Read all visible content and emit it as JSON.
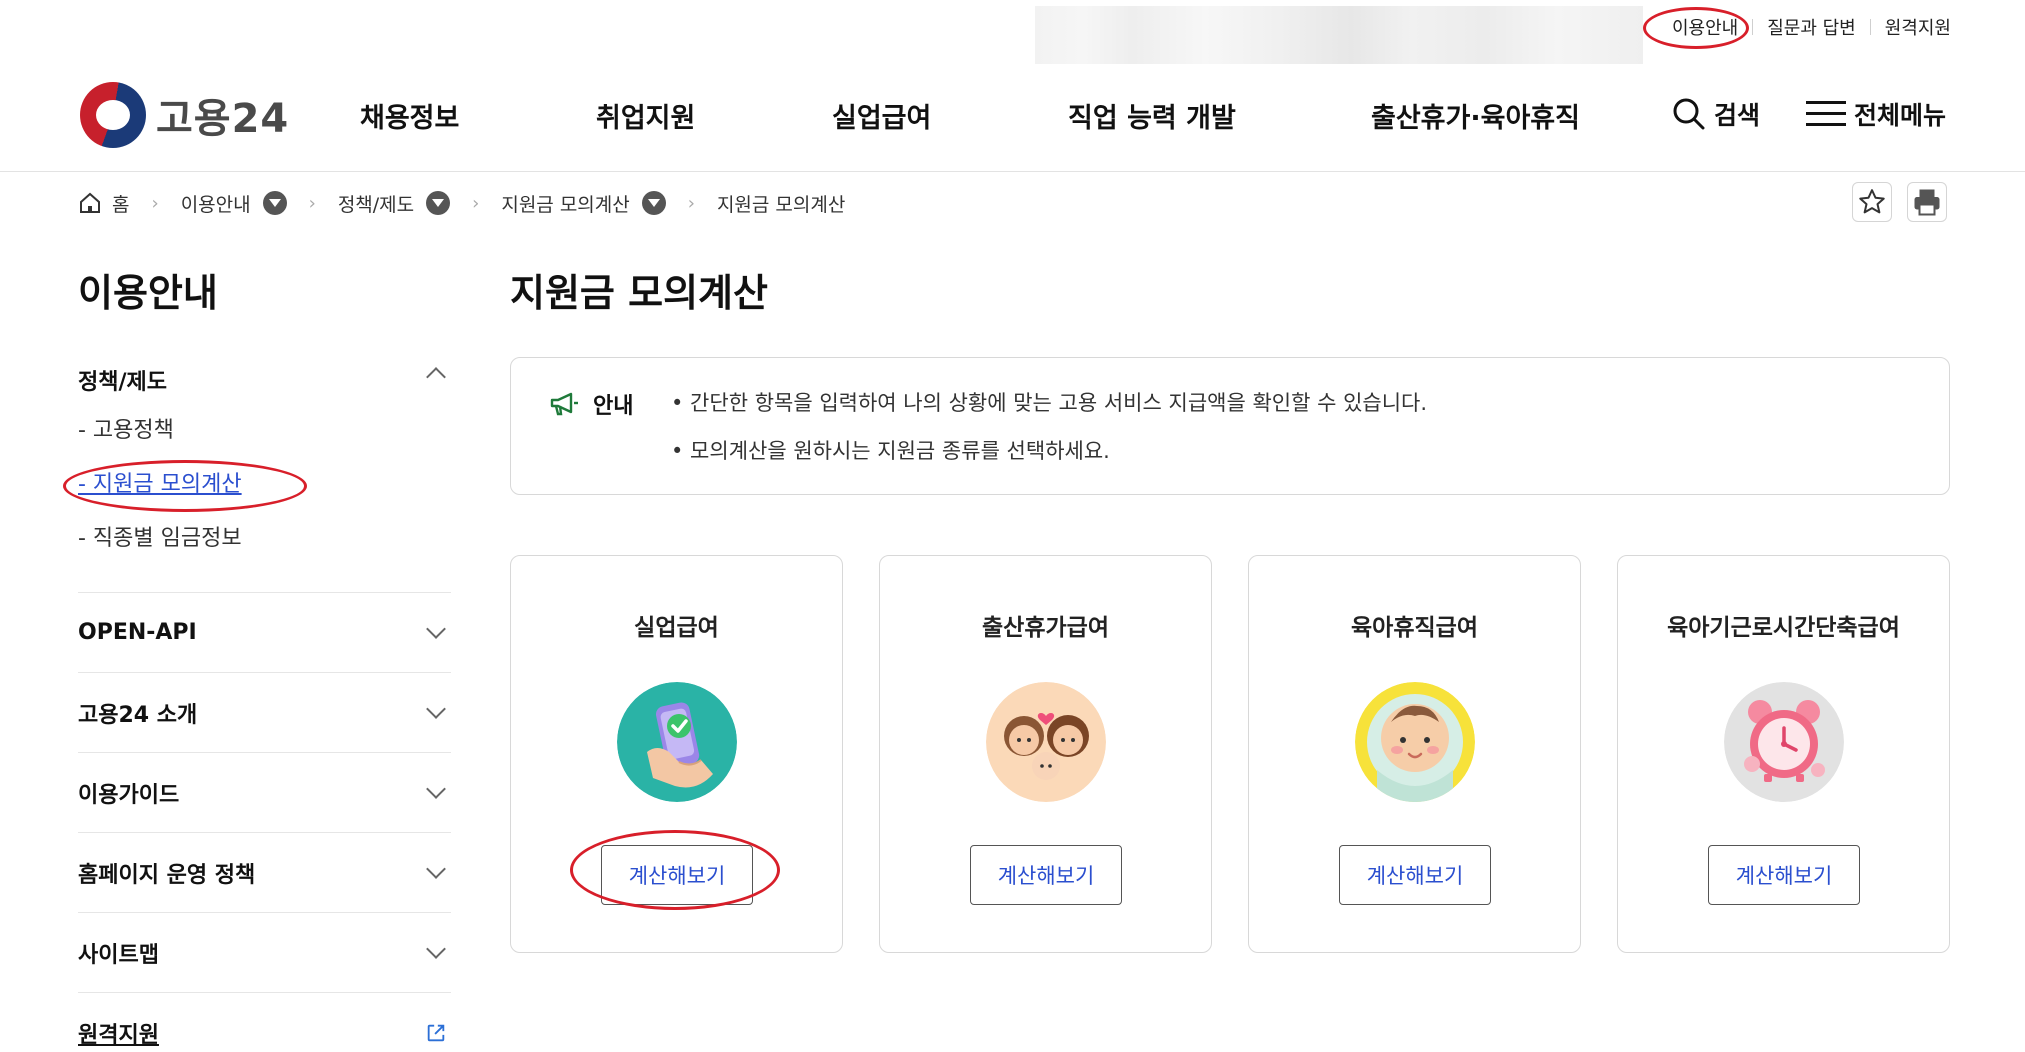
{
  "utility": {
    "links": [
      "이용안내",
      "질문과 답변",
      "원격지원"
    ]
  },
  "header": {
    "logo_text": "고용24",
    "nav": [
      "채용정보",
      "취업지원",
      "실업급여",
      "직업 능력 개발",
      "출산휴가·육아휴직"
    ],
    "search_label": "검색",
    "menu_label": "전체메뉴"
  },
  "breadcrumb": [
    "홈",
    "이용안내",
    "정책/제도",
    "지원금 모의계산",
    "지원금 모의계산"
  ],
  "sidebar": {
    "title": "이용안내",
    "sections": [
      {
        "label": "정책/제도",
        "expanded": true,
        "items": [
          "- 고용정책",
          "- 지원금 모의계산",
          "- 직종별 임금정보"
        ],
        "active_index": 1
      },
      {
        "label": "OPEN-API"
      },
      {
        "label": "고용24 소개"
      },
      {
        "label": "이용가이드"
      },
      {
        "label": "홈페이지 운영 정책"
      },
      {
        "label": "사이트맵"
      },
      {
        "label": "원격지원",
        "external": true
      }
    ]
  },
  "main": {
    "title": "지원금 모의계산",
    "notice": {
      "label": "안내",
      "lines": [
        "• 간단한 항목을 입력하여 나의 상황에 맞는 고용 서비스 지급액을 확인할 수 있습니다.",
        "• 모의계산을 원하시는 지원금 종류를 선택하세요."
      ]
    },
    "cards": [
      {
        "title": "실업급여",
        "button": "계산해보기",
        "icon": "phone-check-icon"
      },
      {
        "title": "출산휴가급여",
        "button": "계산해보기",
        "icon": "parents-baby-icon"
      },
      {
        "title": "육아휴직급여",
        "button": "계산해보기",
        "icon": "baby-face-icon"
      },
      {
        "title": "육아기근로시간단축급여",
        "button": "계산해보기",
        "icon": "alarm-clock-icon"
      }
    ]
  },
  "colors": {
    "accent_blue": "#2b4fcf",
    "annotation_red": "#d81f2a",
    "border": "#d8d8d8"
  }
}
